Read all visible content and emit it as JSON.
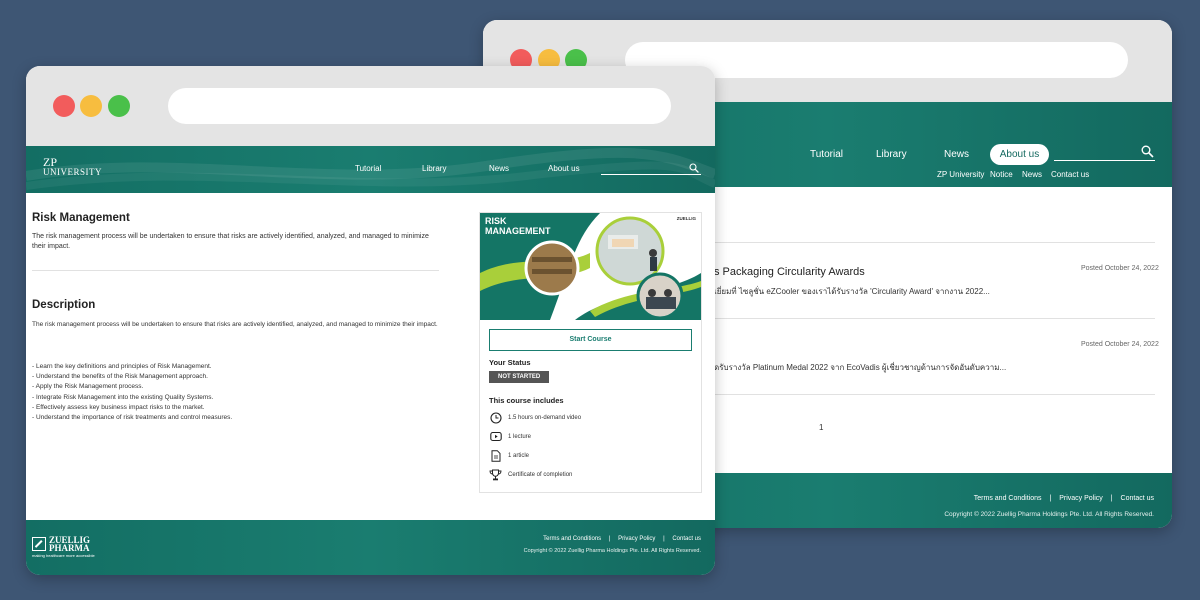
{
  "colors": {
    "background": "#3e5674",
    "teal": "#1a7d70",
    "dot_red": "#f25c5c",
    "dot_yellow": "#f7bd3f",
    "dot_green": "#4ac04a"
  },
  "back_window": {
    "nav": {
      "items": [
        "Tutorial",
        "Library",
        "News",
        "About us"
      ],
      "sub_items": [
        "ZP University",
        "Notice",
        "News",
        "Contact us"
      ]
    },
    "posts": [
      {
        "title": "s Packaging Circularity Awards",
        "date": "Posted October 24, 2022",
        "excerpt": "เยี่ยมที่ ไซลูชั่น eZCooler ของเราได้รับรางวัล 'Circularity Award' จากงาน 2022..."
      },
      {
        "title": "",
        "date": "Posted October 24, 2022",
        "excerpt": "ดรับรางวัล Platinum Medal 2022 จาก EcoVadis ผู้เชี่ยวชาญด้านการจัดอันดับความ..."
      }
    ],
    "pagination": "1",
    "footer": {
      "links": [
        "Terms and Conditions",
        "Privacy Policy",
        "Contact us"
      ],
      "separator": "|",
      "copyright": "Copyright © 2022 Zuellig Pharma Holdings Pte. Ltd. All Rights Reserved."
    }
  },
  "front_window": {
    "logo": {
      "line1": "ZP",
      "line2": "UNIVERSITY"
    },
    "nav": {
      "items": [
        "Tutorial",
        "Library",
        "News",
        "About us"
      ]
    },
    "course": {
      "title": "Risk Management",
      "summary": "The risk management process will be undertaken to ensure that risks are actively identified, analyzed, and managed to minimize their impact.",
      "description_heading": "Description",
      "description": "The risk management process will be undertaken to ensure that risks are actively identified, analyzed, and managed to minimize their impact.",
      "objectives": [
        "- Learn the key definitions and principles of Risk Management.",
        "- Understand the benefits of the Risk Management approach.",
        "- Apply the Risk Management process.",
        "- Integrate Risk Management into the existing Quality Systems.",
        "- Effectively assess key business impact risks to the market.",
        "- Understand the importance of risk treatments and control measures."
      ]
    },
    "card": {
      "image_title_line1": "RISK",
      "image_title_line2": "MANAGEMENT",
      "image_logo": "ZUELLIG",
      "start_label": "Start Course",
      "status_heading": "Your Status",
      "status_badge": "NOT STARTED",
      "includes_heading": "This course includes",
      "includes": [
        {
          "icon": "clock-icon",
          "text": "1.5 hours on-demand video"
        },
        {
          "icon": "video-icon",
          "text": "1 lecture"
        },
        {
          "icon": "document-icon",
          "text": "1 article"
        },
        {
          "icon": "trophy-icon",
          "text": "Certificate of completion"
        }
      ]
    },
    "footer": {
      "brand_line1": "ZUELLIG",
      "brand_line2": "PHARMA",
      "tagline": "making healthcare more accessible",
      "links": [
        "Terms and Conditions",
        "Privacy Policy",
        "Contact us"
      ],
      "separator": "|",
      "copyright": "Copyright © 2022 Zuellig Pharma Holdings Pte. Ltd. All Rights Reserved."
    }
  }
}
